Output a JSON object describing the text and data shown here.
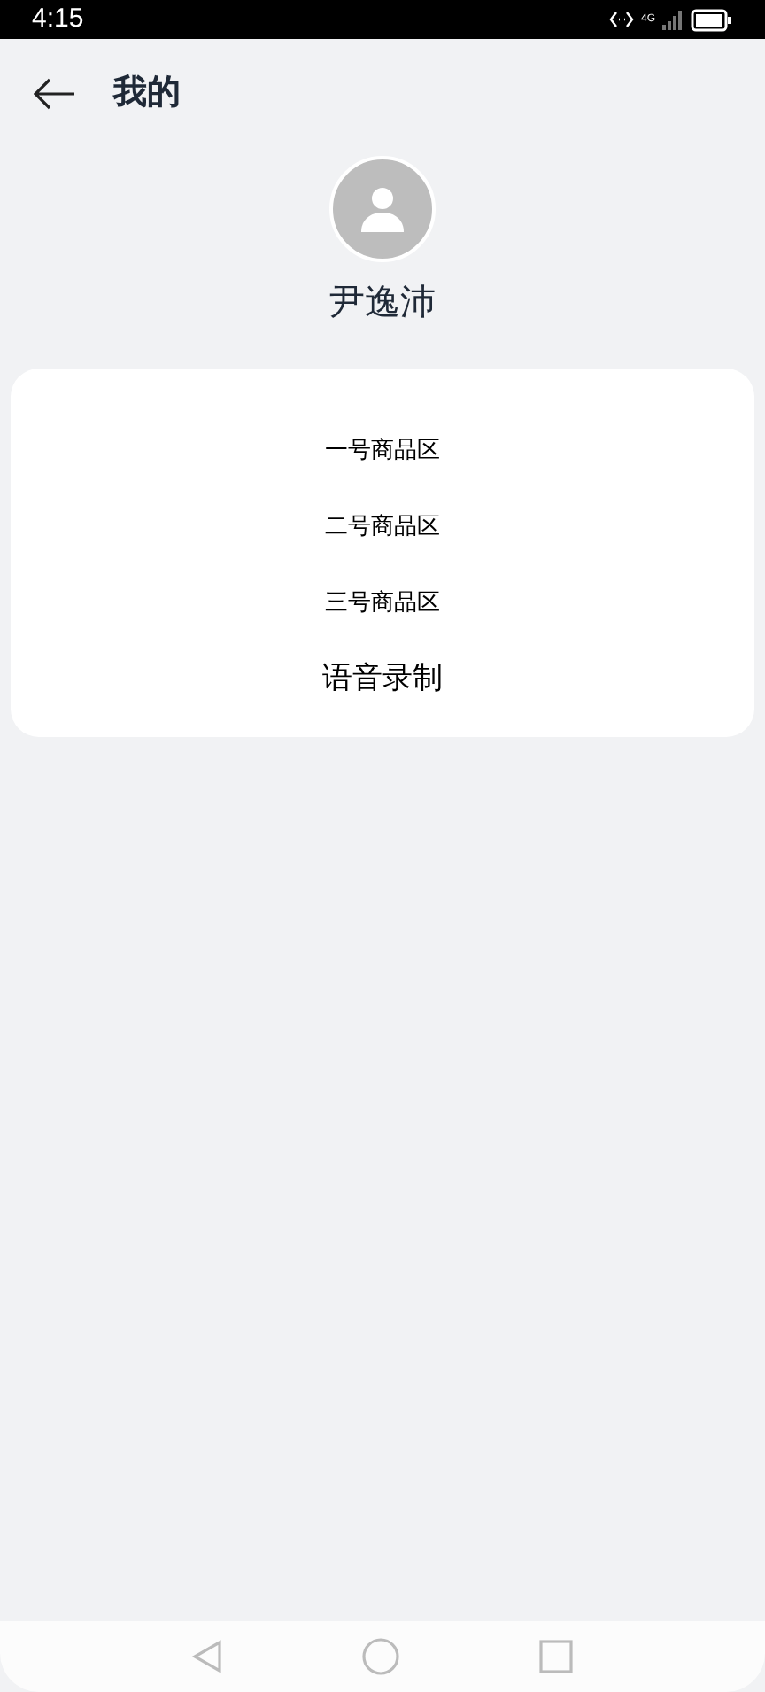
{
  "status_bar": {
    "time": "4:15",
    "network": "4G"
  },
  "header": {
    "title": "我的"
  },
  "profile": {
    "name": "尹逸沛"
  },
  "menu": [
    {
      "label": "一号商品区",
      "kind": "small"
    },
    {
      "label": "二号商品区",
      "kind": "small"
    },
    {
      "label": "三号商品区",
      "kind": "small"
    },
    {
      "label": "语音录制",
      "kind": "large"
    }
  ]
}
